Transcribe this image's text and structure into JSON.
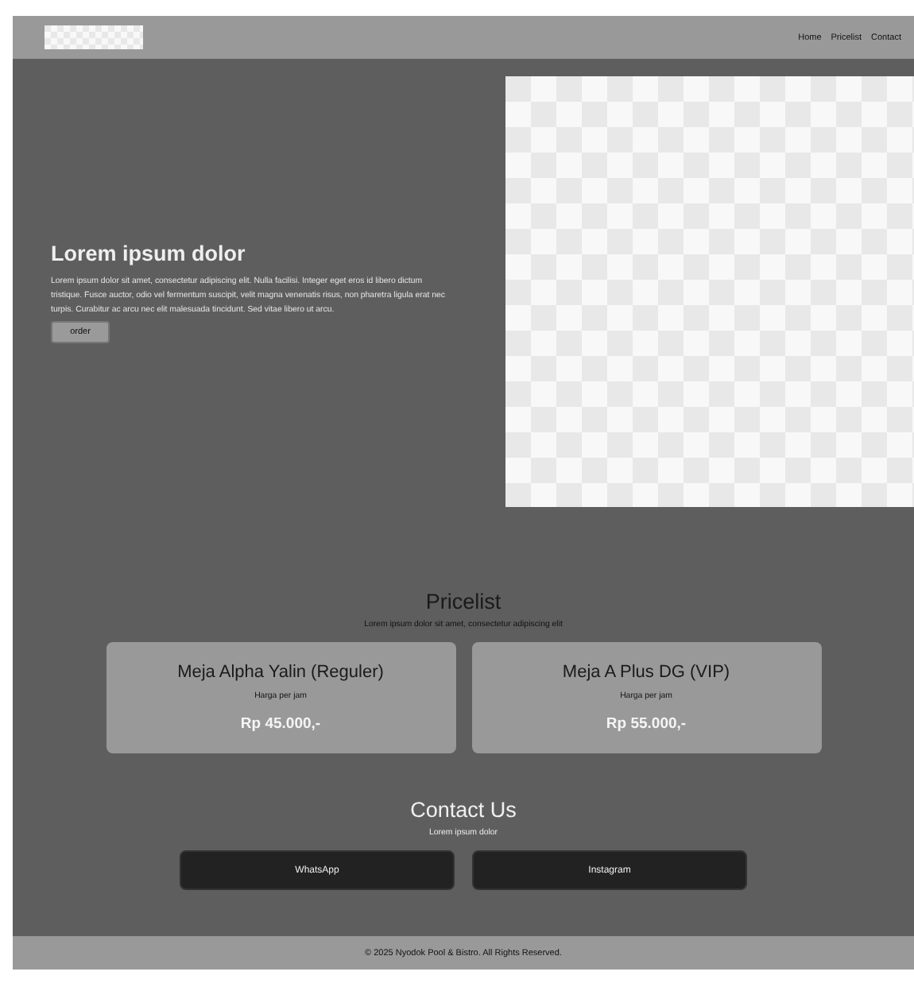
{
  "header": {
    "nav": [
      "Home",
      "Pricelist",
      "Contact"
    ]
  },
  "hero": {
    "title": "Lorem ipsum dolor",
    "text": "Lorem ipsum dolor sit amet, consectetur adipiscing elit. Nulla facilisi. Integer eget eros id libero dictum tristique. Fusce auctor, odio vel fermentum suscipit, velit magna venenatis risus, non pharetra ligula erat nec turpis. Curabitur ac arcu nec elit malesuada tincidunt. Sed vitae libero ut arcu.",
    "button": "order"
  },
  "pricelist": {
    "title": "Pricelist",
    "subtitle": "Lorem ipsum dolor sit amet, consectetur adipiscing elit",
    "cards": [
      {
        "name": "Meja Alpha Yalin (Reguler)",
        "unit": "Harga per jam",
        "price": "Rp 45.000,-"
      },
      {
        "name": "Meja A Plus DG (VIP)",
        "unit": "Harga per jam",
        "price": "Rp 55.000,-"
      }
    ]
  },
  "contact": {
    "title": "Contact Us",
    "subtitle": "Lorem ipsum dolor",
    "buttons": [
      "WhatsApp",
      "Instagram"
    ]
  },
  "footer": "© 2025 Nyodok Pool & Bistro. All Rights Reserved."
}
